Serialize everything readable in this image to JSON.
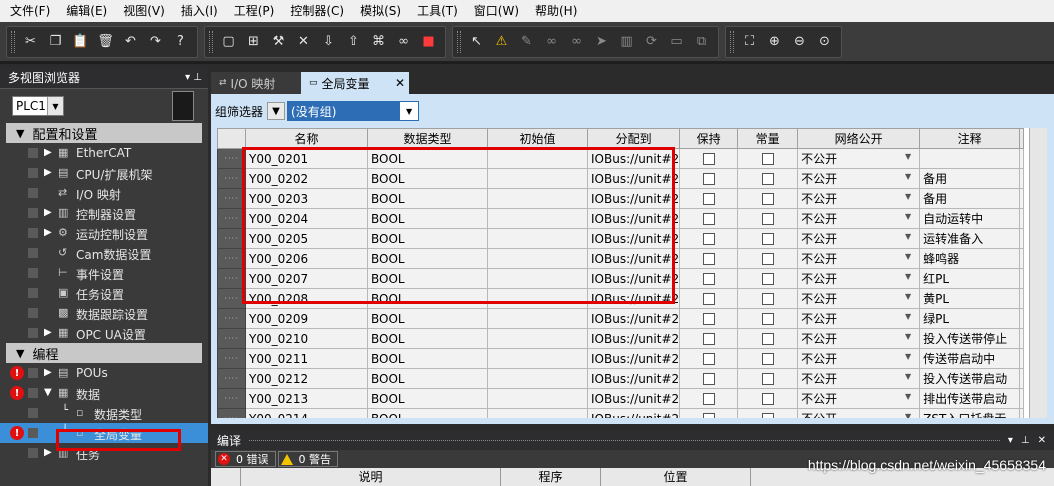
{
  "menubar": {
    "items": [
      "文件(F)",
      "编辑(E)",
      "视图(V)",
      "插入(I)",
      "工程(P)",
      "控制器(C)",
      "模拟(S)",
      "工具(T)",
      "窗口(W)",
      "帮助(H)"
    ]
  },
  "toolbar": {
    "groups": [
      [
        "cut-icon",
        "copy-icon",
        "paste-icon",
        "delete-icon",
        "undo-icon",
        "redo-icon",
        "help-icon"
      ],
      [
        "3d-icon",
        "layout-icon",
        "hammer-icon",
        "tools-icon",
        "download-icon",
        "upload-icon",
        "network-icon",
        "binoculars-icon",
        "stop-icon"
      ],
      [
        "cursor-icon",
        "warning-icon",
        "wrench-icon",
        "glasses-icon",
        "glasses2-icon",
        "forward-icon",
        "rack-icon",
        "cycle-icon",
        "monitor-icon",
        "split-icon"
      ],
      [
        "fit-icon",
        "zoom-in-icon",
        "zoom-out-icon",
        "zoom-reset-icon"
      ]
    ]
  },
  "left_pane": {
    "title": "多视图浏览器",
    "controller": "PLC1",
    "sections": [
      {
        "label": "配置和设置",
        "items": [
          {
            "label": "EtherCAT",
            "expand": "▶",
            "icon": "▦",
            "depth": 1
          },
          {
            "label": "CPU/扩展机架",
            "expand": "▶",
            "icon": "▤",
            "depth": 1
          },
          {
            "label": "I/O 映射",
            "expand": "",
            "icon": "⇄",
            "depth": 1
          },
          {
            "label": "控制器设置",
            "expand": "▶",
            "icon": "▥",
            "depth": 1
          },
          {
            "label": "运动控制设置",
            "expand": "▶",
            "icon": "⚙",
            "depth": 1
          },
          {
            "label": "Cam数据设置",
            "expand": "",
            "icon": "↺",
            "depth": 1
          },
          {
            "label": "事件设置",
            "expand": "",
            "icon": "⊢",
            "depth": 1
          },
          {
            "label": "任务设置",
            "expand": "",
            "icon": "▣",
            "depth": 1
          },
          {
            "label": "数据跟踪设置",
            "expand": "",
            "icon": "▩",
            "depth": 1
          },
          {
            "label": "OPC UA设置",
            "expand": "▶",
            "icon": "▦",
            "depth": 1
          }
        ]
      },
      {
        "label": "编程",
        "items": [
          {
            "label": "POUs",
            "expand": "▶",
            "icon": "▤",
            "depth": 1,
            "error": true
          },
          {
            "label": "数据",
            "expand": "▼",
            "icon": "▦",
            "depth": 1,
            "error": true
          },
          {
            "label": "数据类型",
            "expand": "",
            "icon": "▫",
            "depth": 2
          },
          {
            "label": "全局变量",
            "expand": "",
            "icon": "▫",
            "depth": 2,
            "error": true,
            "selected": true
          },
          {
            "label": "任务",
            "expand": "▶",
            "icon": "▥",
            "depth": 1
          }
        ]
      }
    ]
  },
  "tabs": [
    {
      "label": "I/O 映射",
      "active": false
    },
    {
      "label": "全局变量",
      "active": true
    }
  ],
  "filter": {
    "label": "组筛选器",
    "value": "(没有组)"
  },
  "grid": {
    "headers": [
      "名称",
      "数据类型",
      "初始值",
      "分配到",
      "保持",
      "常量",
      "网络公开",
      "注释"
    ],
    "rows": [
      {
        "name": "Y00_0201",
        "type": "BOOL",
        "init": "",
        "assign": "IOBus://unit#2",
        "net": "不公开",
        "comment": ""
      },
      {
        "name": "Y00_0202",
        "type": "BOOL",
        "init": "",
        "assign": "IOBus://unit#2",
        "net": "不公开",
        "comment": "备用"
      },
      {
        "name": "Y00_0203",
        "type": "BOOL",
        "init": "",
        "assign": "IOBus://unit#2",
        "net": "不公开",
        "comment": "备用"
      },
      {
        "name": "Y00_0204",
        "type": "BOOL",
        "init": "",
        "assign": "IOBus://unit#2",
        "net": "不公开",
        "comment": "自动运转中"
      },
      {
        "name": "Y00_0205",
        "type": "BOOL",
        "init": "",
        "assign": "IOBus://unit#2",
        "net": "不公开",
        "comment": "运转准备入"
      },
      {
        "name": "Y00_0206",
        "type": "BOOL",
        "init": "",
        "assign": "IOBus://unit#2",
        "net": "不公开",
        "comment": "蜂鸣器"
      },
      {
        "name": "Y00_0207",
        "type": "BOOL",
        "init": "",
        "assign": "IOBus://unit#2",
        "net": "不公开",
        "comment": "红PL"
      },
      {
        "name": "Y00_0208",
        "type": "BOOL",
        "init": "",
        "assign": "IOBus://unit#2",
        "net": "不公开",
        "comment": "黄PL"
      },
      {
        "name": "Y00_0209",
        "type": "BOOL",
        "init": "",
        "assign": "IOBus://unit#2",
        "net": "不公开",
        "comment": "绿PL"
      },
      {
        "name": "Y00_0210",
        "type": "BOOL",
        "init": "",
        "assign": "IOBus://unit#2",
        "net": "不公开",
        "comment": "投入传送带停止"
      },
      {
        "name": "Y00_0211",
        "type": "BOOL",
        "init": "",
        "assign": "IOBus://unit#2",
        "net": "不公开",
        "comment": "传送带启动中"
      },
      {
        "name": "Y00_0212",
        "type": "BOOL",
        "init": "",
        "assign": "IOBus://unit#2",
        "net": "不公开",
        "comment": "投入传送带启动"
      },
      {
        "name": "Y00_0213",
        "type": "BOOL",
        "init": "",
        "assign": "IOBus://unit#2",
        "net": "不公开",
        "comment": "排出传送带启动"
      },
      {
        "name": "Y00_0214",
        "type": "BOOL",
        "init": "",
        "assign": "IOBus://unit#2",
        "net": "不公开",
        "comment": "ZST入口托盘无"
      }
    ]
  },
  "bottom": {
    "title": "编译",
    "errors": "0 错误",
    "warnings": "0 警告",
    "columns": [
      "说明",
      "程序",
      "位置"
    ]
  },
  "watermark": "https://blog.csdn.net/weixin_45658354",
  "colors": {
    "highlight": "#e00000",
    "selected_item": "#3b8fd9",
    "filter_select": "#2d6db5",
    "editor_bg": "#cfe3f6"
  }
}
